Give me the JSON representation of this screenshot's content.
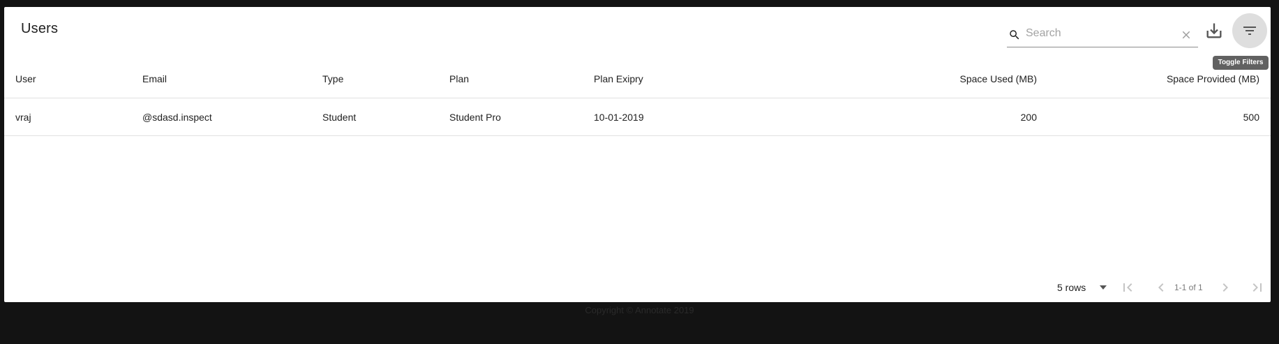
{
  "table_title": "Users",
  "search": {
    "placeholder": "Search",
    "value": ""
  },
  "tooltip": "Toggle Filters",
  "columns": [
    "User",
    "Email",
    "Type",
    "Plan",
    "Plan Exipry",
    "Space Used (MB)",
    "Space Provided (MB)"
  ],
  "rows": [
    [
      "vraj",
      "@sdasd.inspect",
      "Student",
      "Student Pro",
      "10-01-2019",
      "200",
      "500"
    ]
  ],
  "pagination": {
    "rows_per_page": "5 rows",
    "range": "1-1 of 1"
  },
  "footer": {
    "copyright": "Copyright © Annotate 2019"
  },
  "icons": [
    "search-icon",
    "clear-icon",
    "download-icon",
    "filter-list-icon",
    "first-page-icon",
    "prev-page-icon",
    "next-page-icon",
    "last-page-icon",
    "arrow-drop-down-icon"
  ],
  "colors": {
    "page_background": "#131313",
    "paper": "#ffffff",
    "filter_button": "#dedede",
    "tooltip": "#616161"
  }
}
